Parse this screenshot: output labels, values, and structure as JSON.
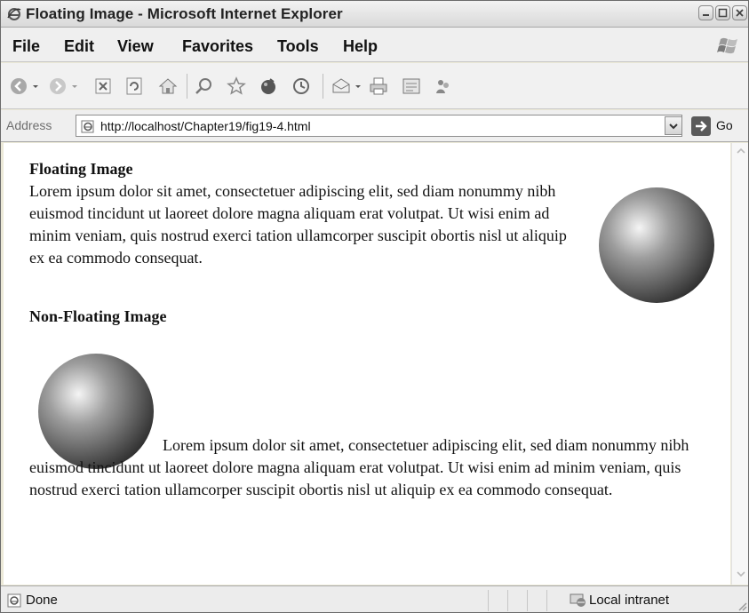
{
  "window": {
    "title": "Floating Image - Microsoft Internet Explorer",
    "icon": "ie-icon"
  },
  "menu": {
    "items": [
      "File",
      "Edit",
      "View",
      "Favorites",
      "Tools",
      "Help"
    ]
  },
  "toolbar": {
    "icons": [
      "back-icon",
      "forward-icon",
      "stop-icon",
      "refresh-icon",
      "home-icon",
      "search-icon",
      "favorites-icon",
      "media-icon",
      "history-icon",
      "mail-icon",
      "print-icon",
      "edit-icon",
      "messenger-icon"
    ]
  },
  "address": {
    "label": "Address",
    "url": "http://localhost/Chapter19/fig19-4.html",
    "go_label": "Go"
  },
  "page": {
    "floating_heading": "Floating Image",
    "floating_text": "Lorem ipsum dolor sit amet, consectetuer adipiscing elit, sed diam nonummy nibh euismod tincidunt ut laoreet dolore magna aliquam erat volutpat. Ut wisi enim ad minim veniam, quis nostrud exerci tation ullamcorper suscipit obortis nisl ut aliquip ex ea commodo consequat.",
    "nonfloating_heading": "Non-Floating Image",
    "nonfloating_text": "Lorem ipsum dolor sit amet, consectetuer adipiscing elit, sed diam nonummy nibh euismod tincidunt ut laoreet dolore magna aliquam erat volutpat. Ut wisi enim ad minim veniam, quis nostrud exerci tation ullamcorper suscipit obortis nisl ut aliquip ex ea commodo consequat."
  },
  "status": {
    "text": "Done",
    "zone": "Local intranet"
  },
  "colors": {
    "chrome": "#efefef",
    "sphere_dark": "#2d2d2d",
    "sphere_light": "#f2f2f2"
  }
}
